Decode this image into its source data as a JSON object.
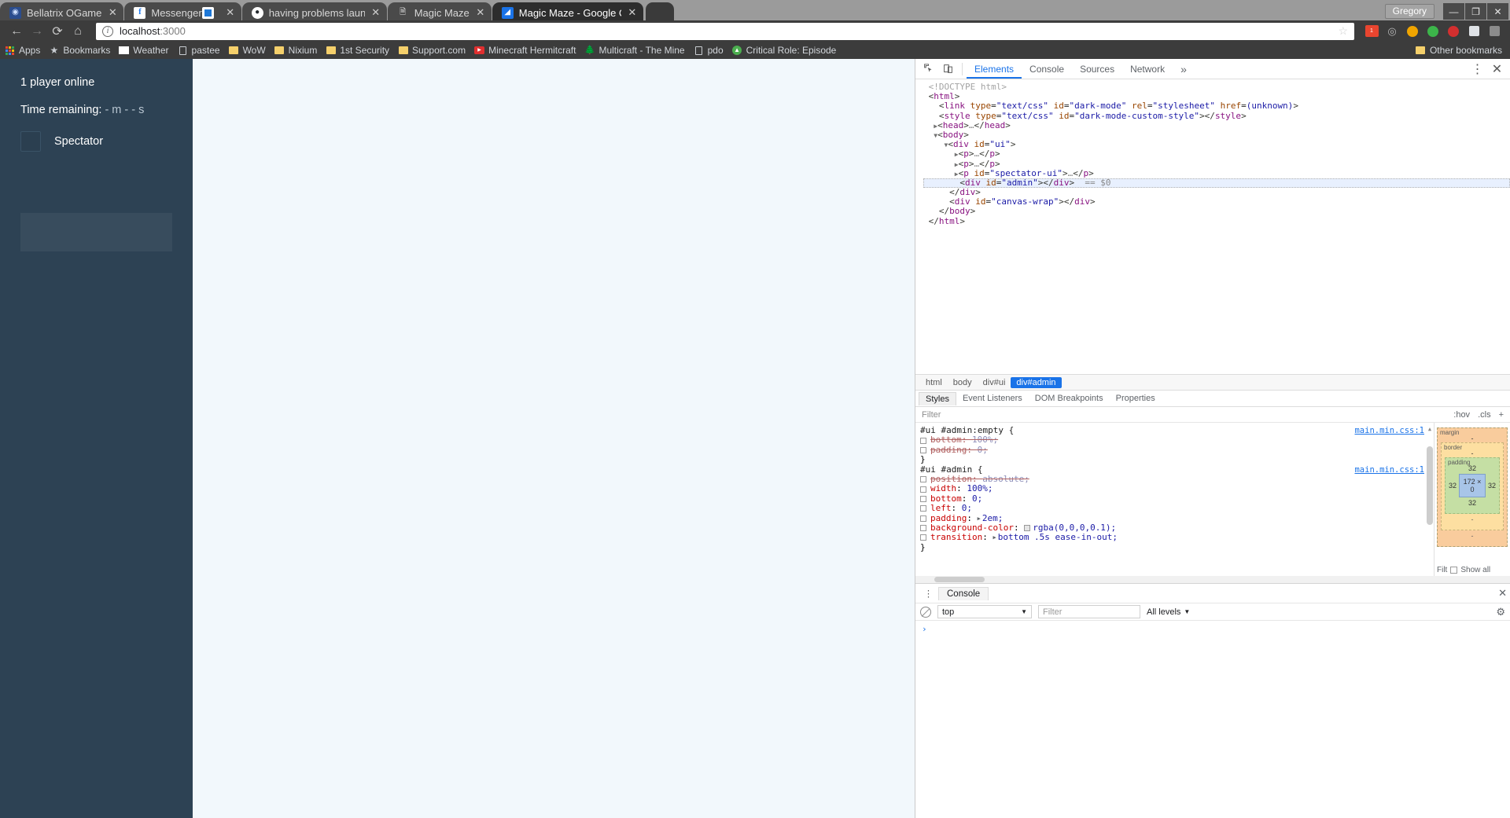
{
  "window": {
    "profile_name": "Gregory",
    "controls": {
      "minimize": "—",
      "maximize": "❐",
      "close": "✕"
    }
  },
  "tabs": [
    {
      "title": "Bellatrix OGame",
      "favicon": "bellatrix-icon",
      "active": false,
      "close": "✕"
    },
    {
      "title": "Messenger",
      "favicon": "messenger-icon",
      "active": false,
      "close": "✕"
    },
    {
      "title": "having problems launchi",
      "favicon": "github-icon",
      "active": false,
      "close": "✕"
    },
    {
      "title": "Magic Maze",
      "favicon": "document-icon",
      "active": false,
      "close": "✕"
    },
    {
      "title": "Magic Maze - Google Ch",
      "favicon": "magic-maze-icon",
      "active": true,
      "close": "✕"
    }
  ],
  "toolbar": {
    "back": "←",
    "forward": "→",
    "reload": "⟳",
    "home": "⌂",
    "url_host": "localhost",
    "url_rest": ":3000",
    "info_glyph": "i",
    "bookmark_star": "☆",
    "extensions": [
      {
        "name": "adblock-extension-icon",
        "badge": "1",
        "color": "#e8452f"
      },
      {
        "name": "cast-extension-icon",
        "color": "#b8b8b8"
      },
      {
        "name": "honey-extension-icon",
        "color": "#f0a500"
      },
      {
        "name": "green-extension-icon",
        "color": "#3cb54a"
      },
      {
        "name": "lastpass-extension-icon",
        "color": "#d32f2f"
      },
      {
        "name": "notes-extension-icon",
        "color": "#9aa0a6"
      },
      {
        "name": "profile-extension-icon",
        "color": "#7a7a7a"
      }
    ]
  },
  "bookmarks": {
    "items": [
      {
        "label": "Apps",
        "icon": "apps-grid-icon"
      },
      {
        "label": "Bookmarks",
        "icon": "star-icon"
      },
      {
        "label": "Weather",
        "icon": "weather-icon"
      },
      {
        "label": "pastee",
        "icon": "page-icon"
      },
      {
        "label": "WoW",
        "icon": "folder-icon"
      },
      {
        "label": "Nixium",
        "icon": "folder-icon"
      },
      {
        "label": "1st Security",
        "icon": "folder-icon"
      },
      {
        "label": "Support.com",
        "icon": "folder-icon"
      },
      {
        "label": "Minecraft Hermitcraft",
        "icon": "youtube-icon"
      },
      {
        "label": "Multicraft - The Mine",
        "icon": "tree-icon"
      },
      {
        "label": "pdo",
        "icon": "page-icon"
      },
      {
        "label": "Critical Role: Episode",
        "icon": "globe-icon"
      }
    ],
    "other_label": "Other bookmarks",
    "other_icon": "folder-icon"
  },
  "game": {
    "players_online": "1 player online",
    "time_label": "Time remaining:",
    "time_value": "- m - - s",
    "spectator_label": "Spectator"
  },
  "devtools": {
    "panel_tabs": [
      {
        "label": "Elements",
        "active": true
      },
      {
        "label": "Console",
        "active": false
      },
      {
        "label": "Sources",
        "active": false
      },
      {
        "label": "Network",
        "active": false
      }
    ],
    "more_glyph": "»",
    "menu_glyph": "⋮",
    "close_glyph": "✕",
    "inspect_icon": "inspect-cursor-icon",
    "device_icon": "device-toolbar-icon",
    "dom_tree": [
      {
        "indent": 0,
        "tri": "",
        "html": "<span class=\"doct\">&lt;!DOCTYPE html&gt;</span>"
      },
      {
        "indent": 0,
        "tri": "",
        "html": "<span class=\"pun\">&lt;</span><span class=\"tg\">html</span><span class=\"pun\">&gt;</span>"
      },
      {
        "indent": 1,
        "tri": "",
        "html": "<span class=\"pun\">&lt;</span><span class=\"tg\">link</span> <span class=\"at\">type</span>=<span class=\"av\">\"text/css\"</span> <span class=\"at\">id</span>=<span class=\"av\">\"dark-mode\"</span> <span class=\"at\">rel</span>=<span class=\"av\">\"stylesheet\"</span> <span class=\"at\">href</span>=<span class=\"av\">(unknown)</span><span class=\"pun\">&gt;</span>"
      },
      {
        "indent": 1,
        "tri": "",
        "html": "<span class=\"pun\">&lt;</span><span class=\"tg\">style</span> <span class=\"at\">type</span>=<span class=\"av\">\"text/css\"</span> <span class=\"at\">id</span>=<span class=\"av\">\"dark-mode-custom-style\"</span><span class=\"pun\">&gt;&lt;/</span><span class=\"tg\">style</span><span class=\"pun\">&gt;</span>"
      },
      {
        "indent": 1,
        "tri": "▶",
        "html": "<span class=\"pun\">&lt;</span><span class=\"tg\">head</span><span class=\"pun\">&gt;</span><span class=\"dots\">…</span><span class=\"pun\">&lt;/</span><span class=\"tg\">head</span><span class=\"pun\">&gt;</span>"
      },
      {
        "indent": 1,
        "tri": "▼",
        "html": "<span class=\"pun\">&lt;</span><span class=\"tg\">body</span><span class=\"pun\">&gt;</span>"
      },
      {
        "indent": 2,
        "tri": "▼",
        "html": "<span class=\"pun\">&lt;</span><span class=\"tg\">div</span> <span class=\"at\">id</span>=<span class=\"av\">\"ui\"</span><span class=\"pun\">&gt;</span>"
      },
      {
        "indent": 3,
        "tri": "▶",
        "html": "<span class=\"pun\">&lt;</span><span class=\"tg\">p</span><span class=\"pun\">&gt;</span><span class=\"dots\">…</span><span class=\"pun\">&lt;/</span><span class=\"tg\">p</span><span class=\"pun\">&gt;</span>"
      },
      {
        "indent": 3,
        "tri": "▶",
        "html": "<span class=\"pun\">&lt;</span><span class=\"tg\">p</span><span class=\"pun\">&gt;</span><span class=\"dots\">…</span><span class=\"pun\">&lt;/</span><span class=\"tg\">p</span><span class=\"pun\">&gt;</span>"
      },
      {
        "indent": 3,
        "tri": "▶",
        "html": "<span class=\"pun\">&lt;</span><span class=\"tg\">p</span> <span class=\"at\">id</span>=<span class=\"av\">\"spectator-ui\"</span><span class=\"pun\">&gt;</span><span class=\"dots\">…</span><span class=\"pun\">&lt;/</span><span class=\"tg\">p</span><span class=\"pun\">&gt;</span>"
      },
      {
        "indent": 3,
        "tri": "",
        "sel": true,
        "html": "<span class=\"pun\">&lt;</span><span class=\"tg\">div</span> <span class=\"at\">id</span>=<span class=\"av\">\"admin\"</span><span class=\"pun\">&gt;&lt;/</span><span class=\"tg\">div</span><span class=\"pun\">&gt;</span>  <span class=\"cmt\">== $0</span>"
      },
      {
        "indent": 2,
        "tri": "",
        "html": "<span class=\"pun\">&lt;/</span><span class=\"tg\">div</span><span class=\"pun\">&gt;</span>"
      },
      {
        "indent": 2,
        "tri": "",
        "html": "<span class=\"pun\">&lt;</span><span class=\"tg\">div</span> <span class=\"at\">id</span>=<span class=\"av\">\"canvas-wrap\"</span><span class=\"pun\">&gt;&lt;/</span><span class=\"tg\">div</span><span class=\"pun\">&gt;</span>"
      },
      {
        "indent": 1,
        "tri": "",
        "html": "<span class=\"pun\">&lt;/</span><span class=\"tg\">body</span><span class=\"pun\">&gt;</span>"
      },
      {
        "indent": 0,
        "tri": "",
        "html": "<span class=\"pun\">&lt;/</span><span class=\"tg\">html</span><span class=\"pun\">&gt;</span>"
      }
    ],
    "breadcrumb": [
      {
        "label": "html",
        "active": false
      },
      {
        "label": "body",
        "active": false
      },
      {
        "label": "div#ui",
        "active": false
      },
      {
        "label": "div#admin",
        "active": true
      }
    ],
    "styles_tabs": [
      {
        "label": "Styles",
        "active": true
      },
      {
        "label": "Event Listeners",
        "active": false
      },
      {
        "label": "DOM Breakpoints",
        "active": false
      },
      {
        "label": "Properties",
        "active": false
      }
    ],
    "filter_placeholder": "Filter",
    "filter_hov": ":hov",
    "filter_cls": ".cls",
    "filter_plus": "+",
    "css_rules": [
      {
        "selector": "#ui #admin:empty {",
        "source": "main.min.css:1",
        "declarations": [
          {
            "prop": "bottom",
            "value": "100%;",
            "struck": true
          },
          {
            "prop": "padding",
            "value": "0;",
            "struck": true
          }
        ],
        "close": "}"
      },
      {
        "selector": "#ui #admin {",
        "source": "main.min.css:1",
        "declarations": [
          {
            "prop": "position",
            "value": "absolute;",
            "struck": true
          },
          {
            "prop": "width",
            "value": "100%;",
            "struck": false
          },
          {
            "prop": "bottom",
            "value": "0;",
            "struck": false
          },
          {
            "prop": "left",
            "value": "0;",
            "struck": false
          },
          {
            "prop": "padding",
            "value": "2em;",
            "struck": false,
            "tri": true
          },
          {
            "prop": "background-color",
            "value": "rgba(0,0,0,0.1);",
            "struck": false,
            "swatch": "rgba(0,0,0,0.1)"
          },
          {
            "prop": "transition",
            "value": "bottom .5s ease-in-out;",
            "struck": false,
            "tri": true,
            "swatch2": true
          }
        ],
        "close": "}"
      }
    ],
    "box_model": {
      "margin_label": "margin",
      "margin_value": "-",
      "border_label": "border",
      "border_value": "-",
      "padding_label": "padding",
      "padding_top": "32",
      "padding_left": "32",
      "padding_right": "32",
      "padding_bottom": "32",
      "content": "172 × 0",
      "bottom_dash_1": "-",
      "bottom_dash_2": "-",
      "footer_filter": "Filt",
      "footer_showall": "Show all"
    },
    "console": {
      "tab_label": "Console",
      "menu_glyph": "⋮",
      "close_glyph": "✕",
      "clear_icon": "clear-console-icon",
      "context": "top",
      "context_caret": "▼",
      "filter_placeholder": "Filter",
      "levels": "All levels",
      "levels_caret": "▼",
      "settings_icon": "settings-gear-icon",
      "prompt": "›"
    }
  }
}
